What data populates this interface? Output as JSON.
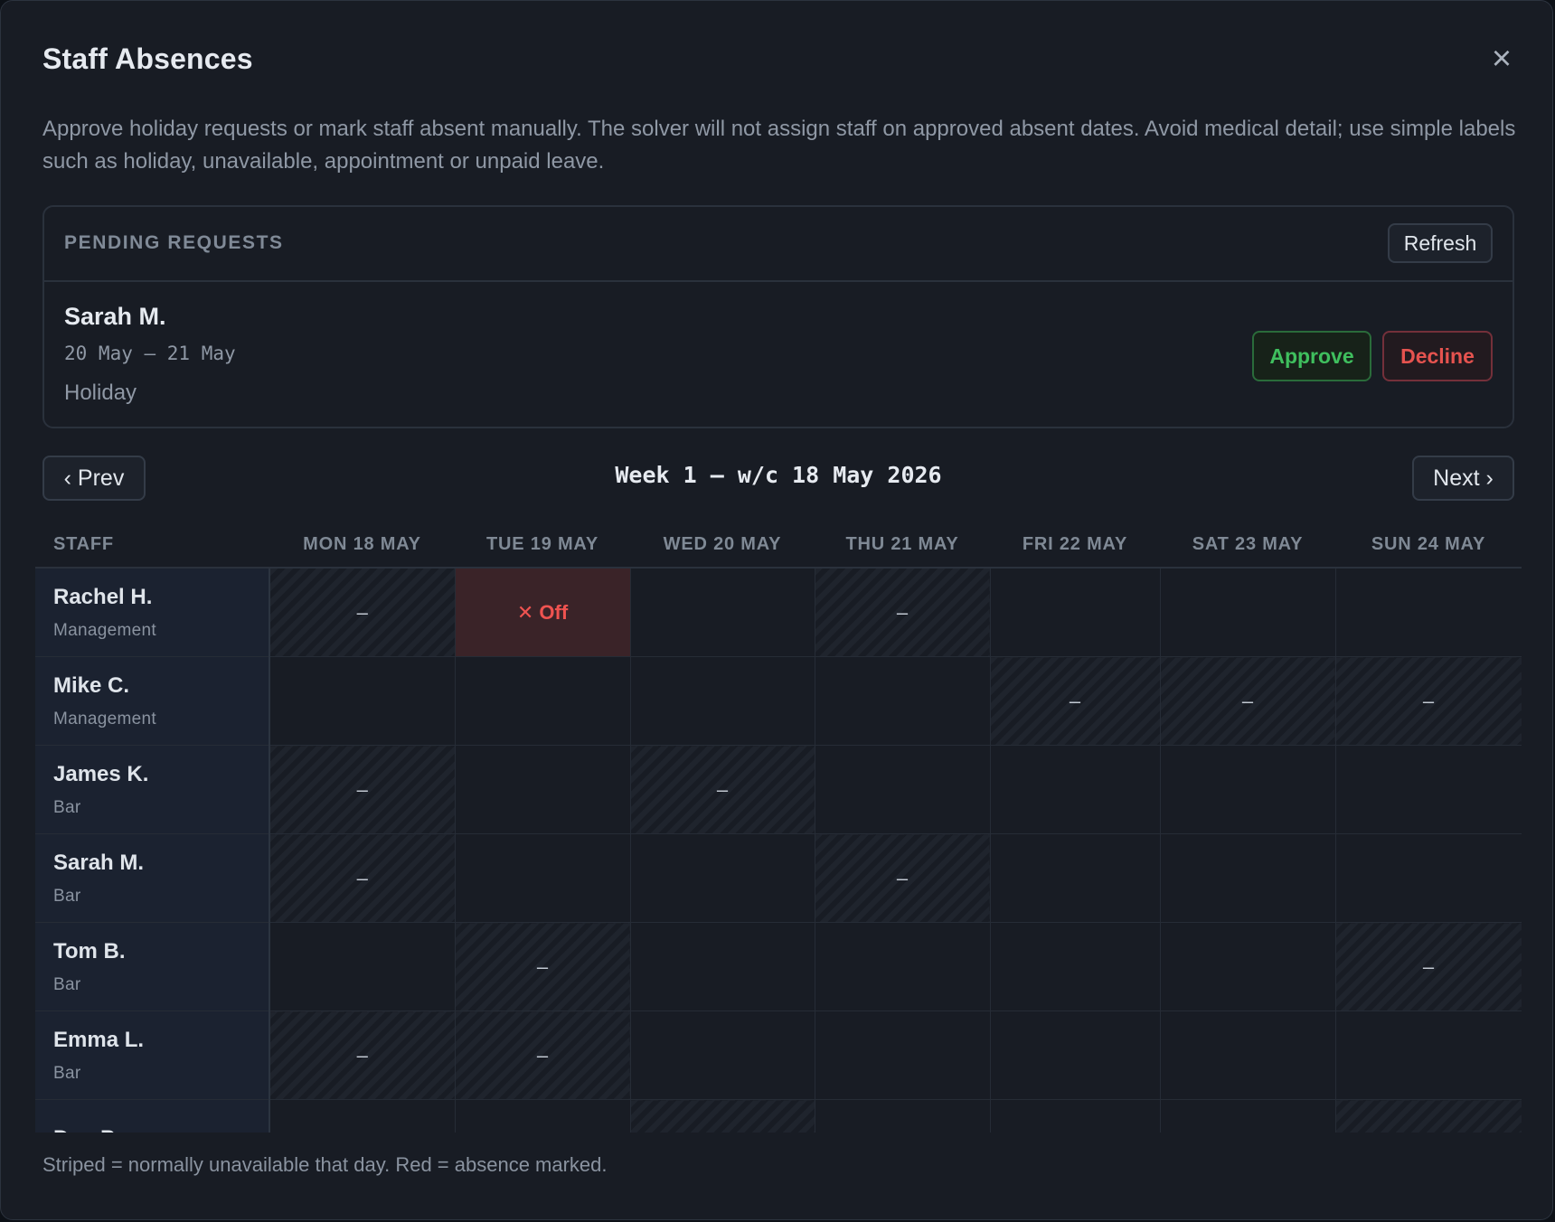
{
  "modal": {
    "title": "Staff Absences",
    "close_icon": "×",
    "description": "Approve holiday requests or mark staff absent manually. The solver will not assign staff on approved absent dates. Avoid medical detail; use simple labels such as holiday, unavailable, appointment or unpaid leave."
  },
  "pending": {
    "title": "PENDING REQUESTS",
    "refresh_label": "Refresh",
    "request": {
      "name": "Sarah M.",
      "dates": "20 May – 21 May",
      "type": "Holiday",
      "approve_label": "Approve",
      "decline_label": "Decline"
    }
  },
  "week_nav": {
    "prev_label": "‹ Prev",
    "next_label": "Next ›",
    "week_label": "Week 1 — w/c 18 May 2026"
  },
  "grid": {
    "staff_header": "STAFF",
    "days": [
      "MON 18 MAY",
      "TUE 19 MAY",
      "WED 20 MAY",
      "THU 21 MAY",
      "FRI 22 MAY",
      "SAT 23 MAY",
      "SUN 24 MAY"
    ],
    "dash": "–",
    "off_label": "✕ Off",
    "rows": [
      {
        "name": "Rachel H.",
        "role": "Management",
        "cells": [
          "u",
          "a",
          "",
          "u",
          "",
          "",
          ""
        ]
      },
      {
        "name": "Mike C.",
        "role": "Management",
        "cells": [
          "",
          "",
          "",
          "",
          "u",
          "u",
          "u"
        ]
      },
      {
        "name": "James K.",
        "role": "Bar",
        "cells": [
          "u",
          "",
          "u",
          "",
          "",
          "",
          ""
        ]
      },
      {
        "name": "Sarah M.",
        "role": "Bar",
        "cells": [
          "u",
          "",
          "",
          "u",
          "",
          "",
          ""
        ]
      },
      {
        "name": "Tom B.",
        "role": "Bar",
        "cells": [
          "",
          "u",
          "",
          "",
          "",
          "",
          "u"
        ]
      },
      {
        "name": "Emma L.",
        "role": "Bar",
        "cells": [
          "u",
          "u",
          "",
          "",
          "",
          "",
          ""
        ]
      },
      {
        "name": "Dan P.",
        "role": "",
        "cells": [
          "",
          "",
          "u",
          "",
          "",
          "",
          "u"
        ]
      }
    ]
  },
  "footer": "Striped = normally unavailable that day. Red = absence marked.",
  "colors": {
    "background": "#181c24",
    "approve": "#3fbf5e",
    "decline": "#e5534f",
    "absent_cell": "#3a2328"
  }
}
